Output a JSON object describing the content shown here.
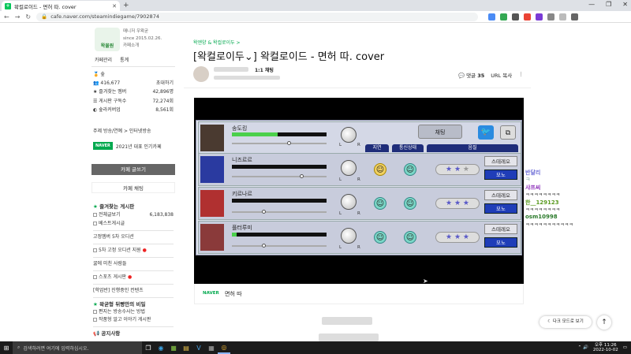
{
  "browser": {
    "tab_title": "왁컬로이드 - 면허 따. cover",
    "url": "cafe.naver.com/steamindiegame/7902874"
  },
  "cafe": {
    "manager_label": "매니저",
    "manager_name": "우왁굳",
    "since": "since 2015.02.26.",
    "cafe_info": "카페소개",
    "manage_link": "카페관리",
    "stats_link": "통계",
    "level": "숲",
    "members_count": "416,677",
    "invite": "초대하기",
    "fav_members_label": "즐겨찾는 멤버",
    "fav_members": "42,896명",
    "subscribers_label": "게시판 구독수",
    "subscribers": "72,274회",
    "visits_label": "숲라커버업",
    "visits": "8,561회",
    "topics": "주제 방송/연예 > 인터넷방송",
    "badge_label": "2021년 대표 인기카페",
    "write_button": "카페 글쓰기",
    "chat_button": "카페 채팅",
    "fav_boards_title": "즐겨찾는 게시판",
    "board1": "전체글보기",
    "board1_count": "6,183,838",
    "board2": "베스트게시글",
    "group1": "고정멤버 5차 오디션",
    "board3": "5차 고정 오디션 지원",
    "group2": "굶에 미친 사람들",
    "board4": "스포츠 게시판",
    "group3": "[학업반] 진행중인 컨텐츠",
    "group4": "왁굳형 뒤빵만의 비밀",
    "board5": "편지는 방송수사는 방법",
    "board6": "작품형 알고 이야기 게시판",
    "notice": "공지사항"
  },
  "article": {
    "breadcrumb": "왁엔양 & 왁컬로이두 >",
    "title": "[왁컬로이두⌄] 왁컬로이드 - 면허 따. cover",
    "author": "1:1 채팅",
    "comments_label": "댓글",
    "comments_count": "35",
    "url_copy": "URL 복사",
    "caption_brand": "NAVER",
    "caption_text": "면허 따"
  },
  "video": {
    "chat_button": "채팅",
    "col_heads": [
      "지연",
      "통신상태",
      "음질"
    ],
    "rows": [
      {
        "name": "송도킹"
      },
      {
        "name": "니즈르르",
        "stereo": "스테레오",
        "mono": "모노"
      },
      {
        "name": "키르나르",
        "stereo": "스테레오",
        "mono": "모노"
      },
      {
        "name": "플터루미",
        "stereo": "스테레오",
        "mono": "모노"
      }
    ]
  },
  "chat": {
    "lines": [
      {
        "name": "반달리",
        "color": "#6b6bd6"
      },
      {
        "name": "ㅋ",
        "color": "#8aa"
      },
      {
        "name": "샤프씨",
        "color": "#8a2bb8"
      },
      {
        "name": "ㅋㅋㅋㅋㅋㅋㅋㅋ",
        "color": "#333"
      },
      {
        "name": "한__129123",
        "color": "#5a9a20"
      },
      {
        "name": "ㅋㅋㅋㅋㅋㅋㅋㅋ",
        "color": "#333"
      },
      {
        "name": "osm10998",
        "color": "#2a7a2a"
      },
      {
        "name": "ㅋㅋㅋㅋㅋㅋㅋㅋㅋㅋㅋ",
        "color": "#333"
      }
    ],
    "dark_mode": "다크 모드로 보기"
  },
  "taskbar": {
    "search_placeholder": "검색하려면 여기에 입력하십시오.",
    "time": "오후 11:26",
    "date": "2022-10-02"
  }
}
